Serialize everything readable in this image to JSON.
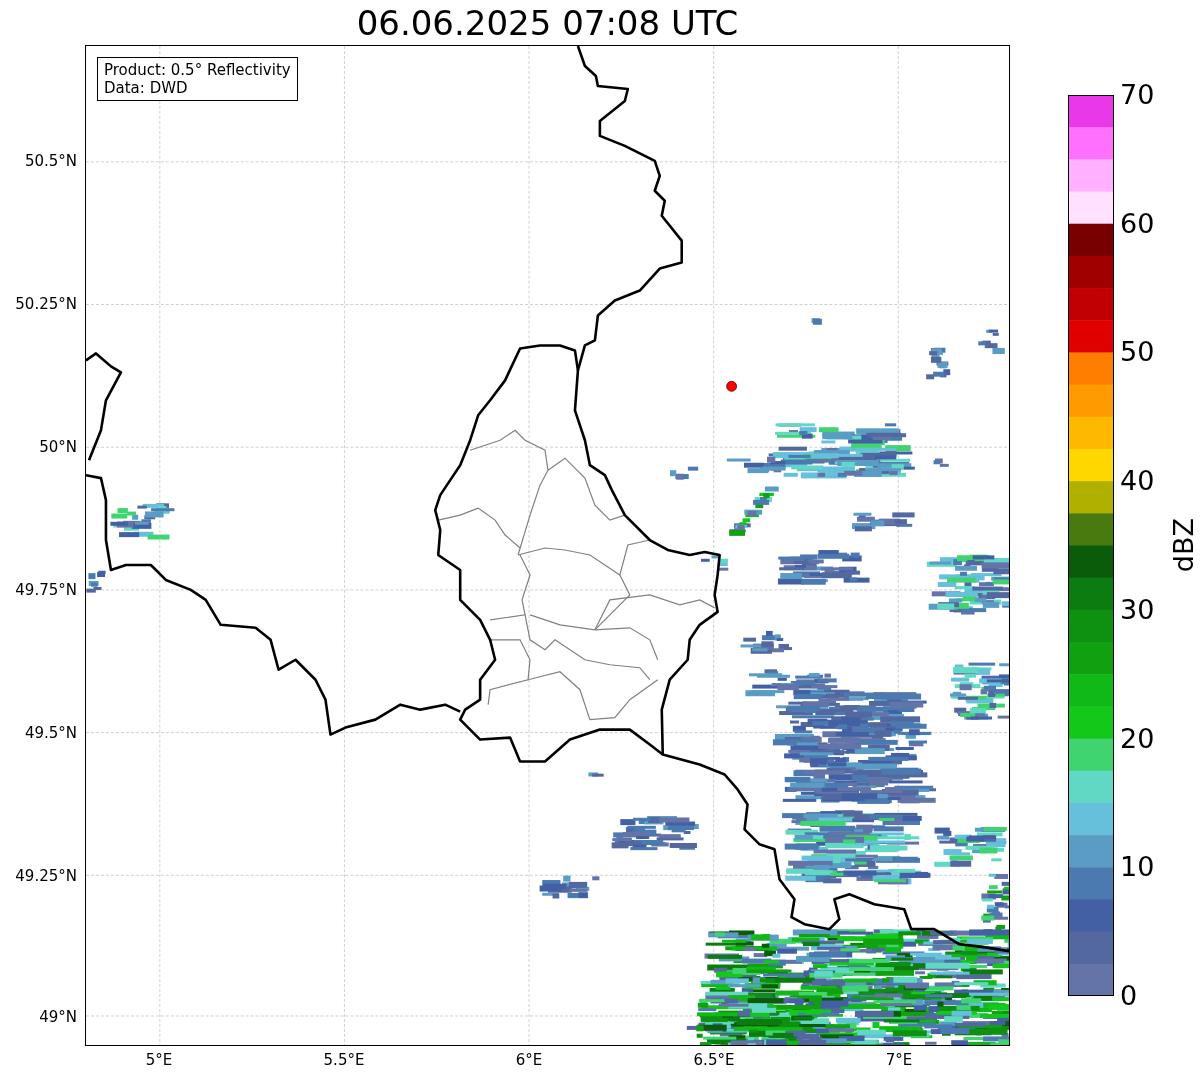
{
  "title": "06.06.2025 07:08 UTC",
  "info_box": [
    "Product: 0.5° Reflectivity",
    "Data: DWD"
  ],
  "map": {
    "yticks": [
      "50.5°N",
      "50.25°N",
      "50°N",
      "49.75°N",
      "49.5°N",
      "49.25°N",
      "49°N"
    ],
    "xticks": [
      "5°E",
      "5.5°E",
      "6°E",
      "6.5°E",
      "7°E"
    ]
  },
  "colorbar": {
    "label": "dBZ",
    "ticks": [
      "70",
      "60",
      "50",
      "40",
      "30",
      "20",
      "10",
      "0"
    ]
  }
}
